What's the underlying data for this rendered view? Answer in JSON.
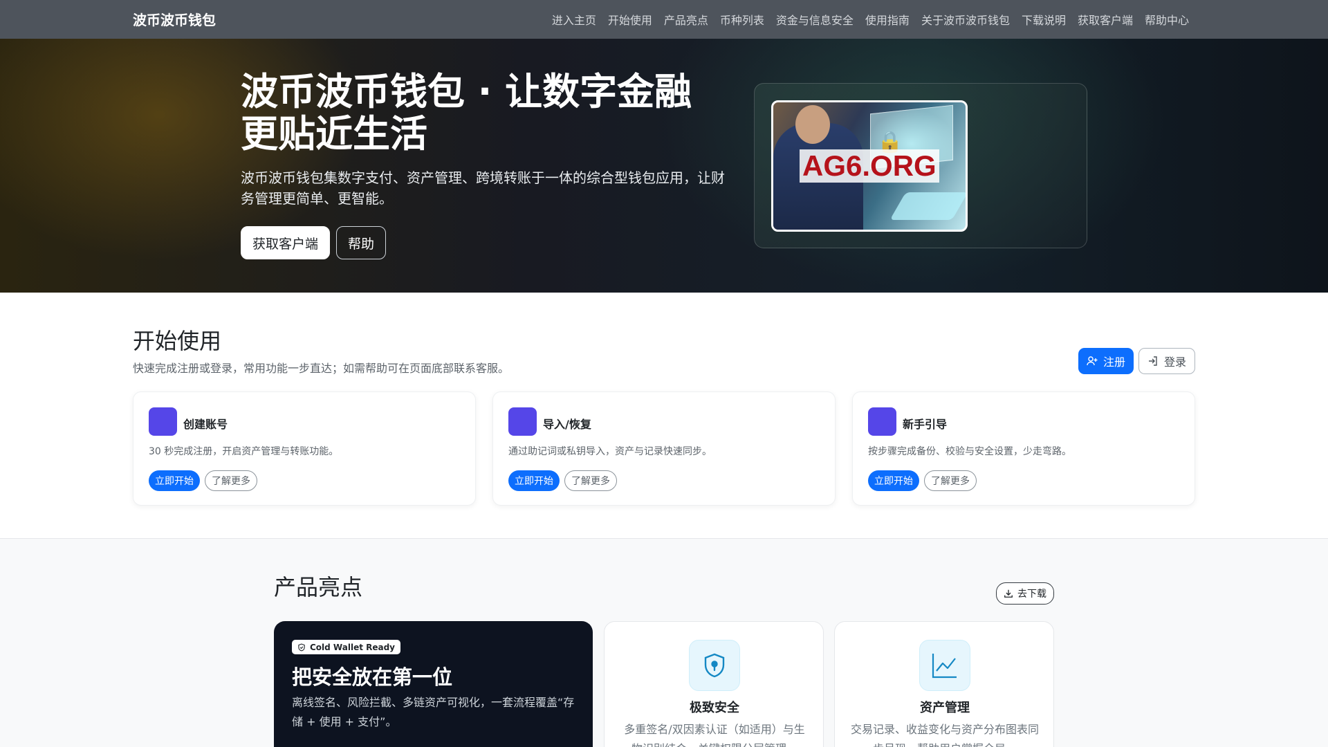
{
  "nav": {
    "brand": "波币波币钱包",
    "links": [
      "进入主页",
      "开始使用",
      "产品亮点",
      "币种列表",
      "资金与信息安全",
      "使用指南",
      "关于波币波币钱包",
      "下载说明",
      "获取客户端",
      "帮助中心"
    ]
  },
  "hero": {
    "title": "波币波币钱包 · 让数字金融更贴近生活",
    "subtitle": "波币波币钱包集数字支付、资产管理、跨境转账于一体的综合型钱包应用，让财务管理更简单、更智能。",
    "btn_primary": "获取客户端",
    "btn_secondary": "帮助",
    "watermark": "AG6.ORG"
  },
  "start": {
    "title": "开始使用",
    "subtitle": "快速完成注册或登录，常用功能一步直达；如需帮助可在页面底部联系客服。",
    "register": "注册",
    "login": "登录",
    "cards": [
      {
        "title": "创建账号",
        "desc": "30 秒完成注册，开启资产管理与转账功能。",
        "primary": "立即开始",
        "secondary": "了解更多"
      },
      {
        "title": "导入/恢复",
        "desc": "通过助记词或私钥导入，资产与记录快速同步。",
        "primary": "立即开始",
        "secondary": "了解更多"
      },
      {
        "title": "新手引导",
        "desc": "按步骤完成备份、校验与安全设置，少走弯路。",
        "primary": "立即开始",
        "secondary": "了解更多"
      }
    ]
  },
  "highlights": {
    "title": "产品亮点",
    "download": "去下载",
    "dark": {
      "badge": "Cold Wallet Ready",
      "title": "把安全放在第一位",
      "desc": "离线签名、风险拦截、多链资产可视化，一套流程覆盖“存储 + 使用 + 支付”。"
    },
    "features": [
      {
        "title": "极致安全",
        "desc": "多重签名/双因素认证（如适用）与生物识别结合，关键权限分层管理。",
        "icon": "shield-lock-icon"
      },
      {
        "title": "资产管理",
        "desc": "交易记录、收益变化与资产分布图表同步呈现，帮助用户掌握全局。",
        "icon": "line-chart-icon"
      }
    ]
  },
  "colors": {
    "primary": "#0d6efd",
    "card_icon": "#5546e8",
    "navbar": "#4e545c",
    "dark_card": "#0d1320",
    "watermark": "#b5121b"
  }
}
